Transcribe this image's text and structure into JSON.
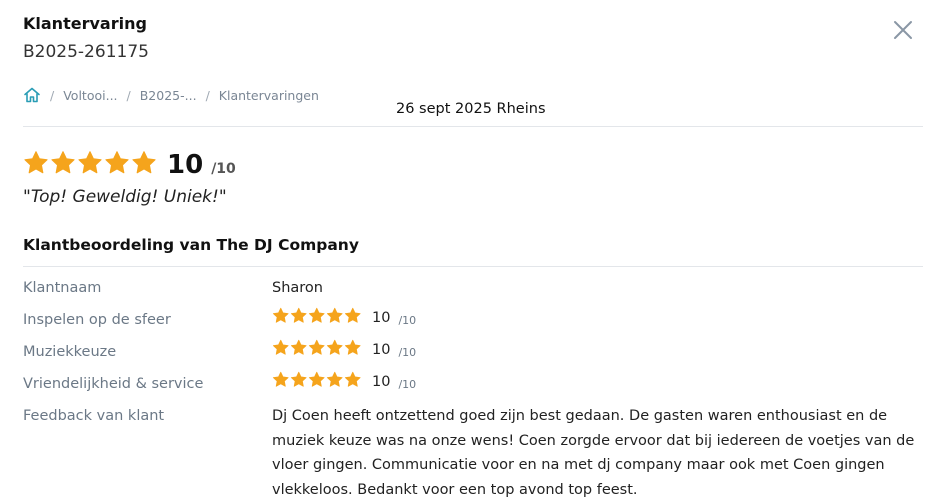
{
  "header": {
    "title": "Klantervaring",
    "booking_number": "B2025-261175",
    "close_icon": "close-icon"
  },
  "breadcrumb": {
    "home_icon": "home-icon",
    "items": [
      "Voltooi...",
      "B2025-...",
      "Klantervaringen"
    ],
    "separator": "/"
  },
  "event_line": "26 sept 2025 Rheins",
  "overall": {
    "stars": 5,
    "score": "10",
    "max": "/10",
    "quote": "\"Top! Geweldig! Uniek!\""
  },
  "review": {
    "section_title": "Klantbeoordeling van The DJ Company",
    "customer_name_label": "Klantnaam",
    "customer_name": "Sharon",
    "ratings": [
      {
        "label": "Inspelen op de sfeer",
        "stars": 5,
        "score": "10",
        "max": "/10"
      },
      {
        "label": "Muziekkeuze",
        "stars": 5,
        "score": "10",
        "max": "/10"
      },
      {
        "label": "Vriendelijkheid & service",
        "stars": 5,
        "score": "10",
        "max": "/10"
      }
    ],
    "feedback_label": "Feedback van klant",
    "feedback": "Dj Coen heeft ontzettend goed zijn best gedaan. De gasten waren enthousiast en de muziek keuze was na onze wens! Coen zorgde ervoor dat bij iedereen de voetjes van de vloer gingen. Communicatie voor en na met dj company maar ook met Coen gingen vlekkeloos. Bedankt voor een top avond top feest."
  },
  "colors": {
    "star": "#F5A41C",
    "accent": "#2a9db5",
    "label": "#6b7886",
    "divider": "#e3e6ea"
  }
}
